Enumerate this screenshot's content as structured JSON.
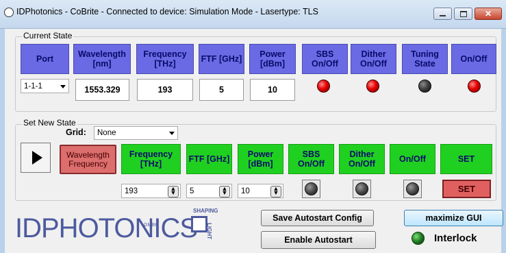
{
  "window": {
    "title": "IDPhotonics - CoBrite - Connected to device: Simulation Mode - Lasertype: TLS",
    "minimize_icon": "minimize-icon",
    "maximize_icon": "maximize-icon",
    "close_icon": "close-icon",
    "close_label": "✕"
  },
  "current_state": {
    "group_label": "Current State",
    "headers": {
      "port": "Port",
      "wavelength": "Wavelength [nm]",
      "frequency": "Frequency [THz]",
      "ftf": "FTF [GHz]",
      "power": "Power [dBm]",
      "sbs": "SBS On/Off",
      "dither": "Dither On/Off",
      "tuning": "Tuning State",
      "onoff": "On/Off"
    },
    "port_value": "1-1-1",
    "wavelength_value": "1553.329",
    "frequency_value": "193",
    "ftf_value": "5",
    "power_value": "10",
    "leds": {
      "sbs": "red",
      "dither": "red",
      "tuning": "dark",
      "onoff": "red"
    }
  },
  "set_new_state": {
    "group_label": "Set New State",
    "grid_label": "Grid:",
    "grid_value": "None",
    "play_icon": "play-icon",
    "mode_button": "Wavelength Frequency",
    "headers": {
      "frequency": "Frequency [THz]",
      "ftf": "FTF [GHz]",
      "power": "Power [dBm]",
      "sbs": "SBS On/Off",
      "dither": "Dither On/Off",
      "onoff": "On/Off",
      "set": "SET"
    },
    "frequency_input": "193",
    "ftf_input": "5",
    "power_input": "10",
    "set_button": "SET"
  },
  "footer": {
    "logo_text": "IDPHOTONICS",
    "logo_gmbh": "GMBH",
    "logo_shaping": "SHAPING",
    "logo_light": "LIGHT",
    "save_autostart": "Save Autostart Config",
    "enable_autostart": "Enable Autostart",
    "maximize_gui": "maximize GUI",
    "interlock_label": "Interlock"
  },
  "colors": {
    "header_blue": "#6a6ae4",
    "header_green": "#20d020",
    "mode_button_red": "#dc6e6e",
    "set_button_red": "#e06060",
    "led_red": "#e50000",
    "interlock_green": "#1f7a1f"
  }
}
